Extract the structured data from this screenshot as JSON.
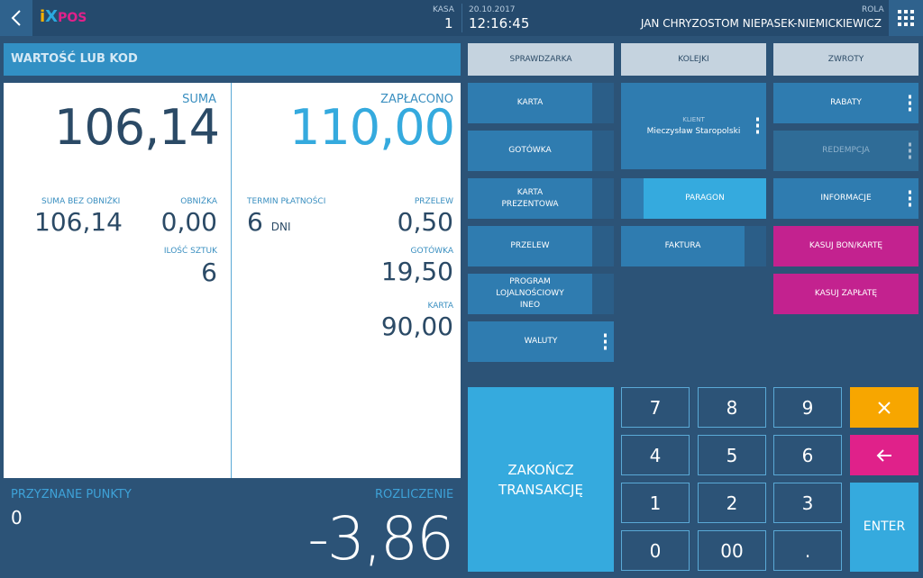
{
  "header": {
    "back_icon": "chevron-left-icon",
    "logo": {
      "i": "i",
      "x": "X",
      "pos": "POS"
    },
    "kasa_label": "KASA",
    "kasa_value": "1",
    "date": "20.10.2017",
    "time": "12:16:45",
    "rola_label": "ROLA",
    "user_name": "JAN CHRYZOSTOM NIEPASEK-NIEMICKIEWICZ",
    "menu_icon": "grid-menu-icon"
  },
  "search": {
    "placeholder": "WARTOŚĆ LUB KOD"
  },
  "summary": {
    "suma_label": "SUMA",
    "suma_value": "106,14",
    "zaplacono_label": "ZAPŁACONO",
    "zaplacono_value": "110,00",
    "suma_bez_obnizki_label": "SUMA BEZ OBNIŻKI",
    "suma_bez_obnizki_value": "106,14",
    "obnizka_label": "OBNIŻKA",
    "obnizka_value": "0,00",
    "ilosc_sztuk_label": "ILOŚĆ SZTUK",
    "ilosc_sztuk_value": "6",
    "termin_label": "TERMIN PŁATNOŚCI",
    "termin_value": "6",
    "termin_unit": "DNI",
    "payments": [
      {
        "label": "PRZELEW",
        "value": "0,50"
      },
      {
        "label": "GOTÓWKA",
        "value": "19,50"
      },
      {
        "label": "KARTA",
        "value": "90,00"
      }
    ]
  },
  "footer_left": {
    "points_label": "PRZYZNANE PUNKTY",
    "points_value": "0",
    "settlement_label": "ROZLICZENIE",
    "settlement_value": "-3,86"
  },
  "top_buttons": {
    "sprawdzarka": "SPRAWDZARKA",
    "kolejki": "KOLEJKI",
    "zwroty": "ZWROTY"
  },
  "payment_buttons": {
    "karta": "KARTA",
    "gotowka": "GOTÓWKA",
    "karta_prezentowa_1": "KARTA",
    "karta_prezentowa_2": "PREZENTOWA",
    "przelew": "PRZELEW",
    "program_1": "PROGRAM",
    "program_2": "LOJALNOŚCIOWY",
    "program_3": "INEO",
    "waluty": "WALUTY"
  },
  "client": {
    "label": "KLIENT",
    "name": "Mieczysław Staropolski"
  },
  "doc_buttons": {
    "paragon": "PARAGON",
    "faktura": "FAKTURA"
  },
  "right_buttons": {
    "rabaty": "RABATY",
    "redempcja": "REDEMPCJA",
    "informacje": "INFORMACJE",
    "kasuj_bon": "KASUJ BON/KARTĘ",
    "kasuj_zaplate": "KASUJ ZAPŁATĘ"
  },
  "finish": {
    "line1": "ZAKOŃCZ",
    "line2": "TRANSAKCJĘ"
  },
  "keypad": {
    "keys": [
      "7",
      "8",
      "9",
      "4",
      "5",
      "6",
      "1",
      "2",
      "3",
      "0",
      "00",
      "."
    ],
    "enter": "ENTER",
    "clear_icon": "close-icon",
    "backspace_icon": "arrow-left-icon",
    "colors": {
      "clear": "#f7a600",
      "backspace": "#e0218a",
      "enter": "#35aade"
    }
  }
}
